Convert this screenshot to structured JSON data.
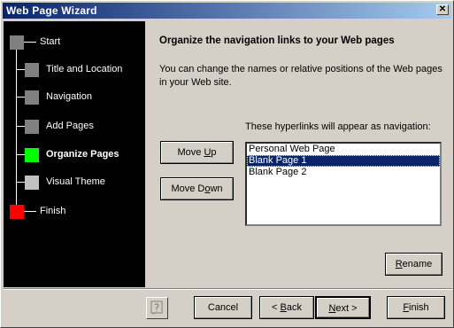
{
  "window": {
    "title": "Web Page Wizard"
  },
  "steps": [
    {
      "label": "Start",
      "state": "done",
      "color": "#808080"
    },
    {
      "label": "Title and Location",
      "state": "done",
      "color": "#808080"
    },
    {
      "label": "Navigation",
      "state": "done",
      "color": "#808080"
    },
    {
      "label": "Add Pages",
      "state": "done",
      "color": "#808080"
    },
    {
      "label": "Organize Pages",
      "state": "current",
      "color": "#00ff00"
    },
    {
      "label": "Visual Theme",
      "state": "pending",
      "color": "#c0c0c0"
    },
    {
      "label": "Finish",
      "state": "end",
      "color": "#ff0000"
    }
  ],
  "main": {
    "heading": "Organize the navigation links to your Web pages",
    "description": "You can change the names or relative positions of the Web pages in your Web site.",
    "list_label": "These hyperlinks will appear as navigation:",
    "items": [
      "Personal Web Page",
      "Blank Page 1",
      "Blank Page 2"
    ],
    "selected_index": 1,
    "move_up": {
      "pre": "Move ",
      "key": "U",
      "post": "p"
    },
    "move_down": {
      "pre": "Move D",
      "key": "o",
      "post": "wn"
    },
    "rename": {
      "pre": "",
      "key": "R",
      "post": "ename"
    }
  },
  "footer": {
    "cancel": "Cancel",
    "back": {
      "pre": "< ",
      "key": "B",
      "post": "ack"
    },
    "next": {
      "pre": "",
      "key": "N",
      "post": "ext >"
    },
    "finish": {
      "pre": "",
      "key": "F",
      "post": "inish"
    }
  }
}
